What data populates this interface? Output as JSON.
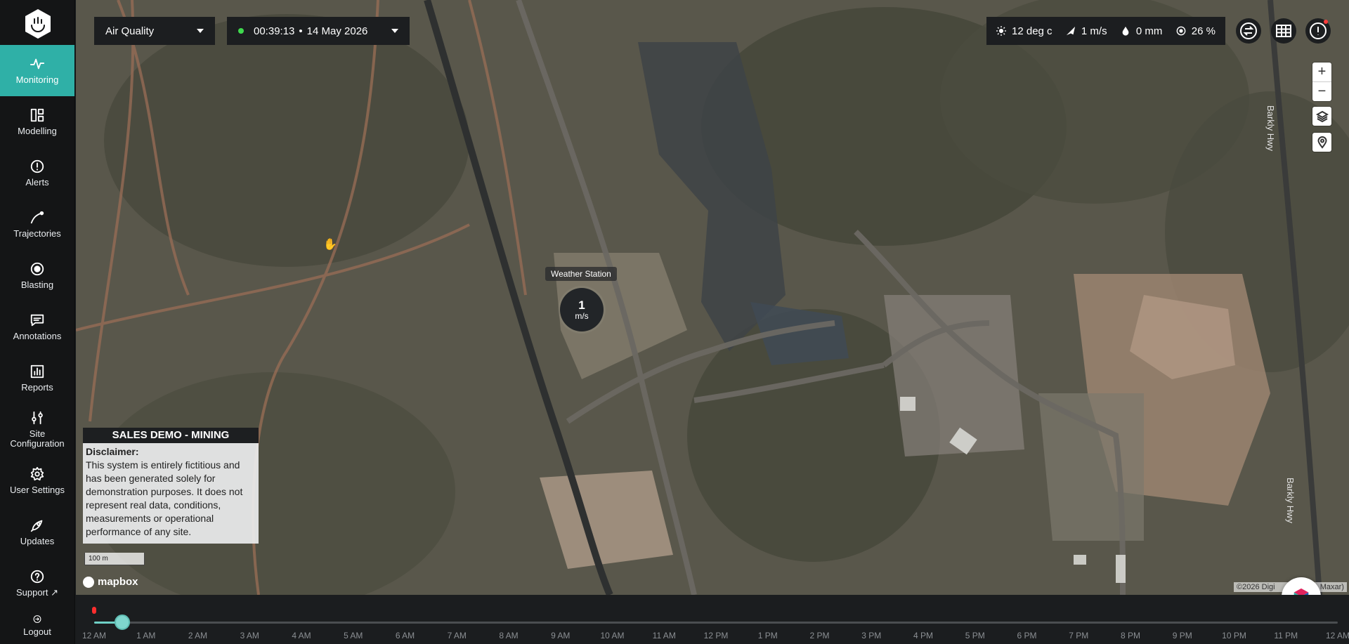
{
  "sidebar": {
    "items": [
      {
        "label": "Monitoring",
        "icon": "pulse-icon"
      },
      {
        "label": "Modelling",
        "icon": "modelling-icon"
      },
      {
        "label": "Alerts",
        "icon": "alert-circle-icon"
      },
      {
        "label": "Trajectories",
        "icon": "trajectory-icon"
      },
      {
        "label": "Blasting",
        "icon": "target-icon"
      },
      {
        "label": "Annotations",
        "icon": "comment-icon"
      },
      {
        "label": "Reports",
        "icon": "bar-chart-icon"
      },
      {
        "label": "Site Configuration",
        "icon": "sliders-icon"
      },
      {
        "label": "User Settings",
        "icon": "gear-icon"
      },
      {
        "label": "Updates",
        "icon": "rocket-icon"
      },
      {
        "label": "Support",
        "icon": "help-icon"
      },
      {
        "label": "Logout",
        "icon": "logout-icon"
      }
    ],
    "active_index": 0
  },
  "header": {
    "layer_select": "Air Quality",
    "time": "00:39:13",
    "date": "14 May 2026",
    "separator": "•"
  },
  "weather": {
    "temperature": "12 deg c",
    "wind": "1 m/s",
    "rain": "0 mm",
    "humidity": "26 %"
  },
  "map": {
    "station_label": "Weather Station",
    "station_value": "1",
    "station_unit": "m/s",
    "road_label": "Barkly Hwy",
    "scale": "100 m",
    "mapbox": "mapbox",
    "attribution": "©2026 Digi",
    "attribution_tail": "Maxar)"
  },
  "disclaimer": {
    "heading": "SALES DEMO - MINING",
    "title": "Disclaimer:",
    "body": "This system is entirely fictitious and has been generated solely for demonstration purposes. It does not represent real data, conditions, measurements or operational performance of any site."
  },
  "timeline": {
    "labels": [
      "12 AM",
      "1 AM",
      "2 AM",
      "3 AM",
      "4 AM",
      "5 AM",
      "6 AM",
      "7 AM",
      "8 AM",
      "9 AM",
      "10 AM",
      "11 AM",
      "12 PM",
      "1 PM",
      "2 PM",
      "3 PM",
      "4 PM",
      "5 PM",
      "6 PM",
      "7 PM",
      "8 PM",
      "9 PM",
      "10 PM",
      "11 PM",
      "12 AM"
    ],
    "progress": 0.0227
  },
  "colors": {
    "accent": "#2fb0a7",
    "live": "#3fd94e",
    "alert": "#ff3b3b"
  }
}
